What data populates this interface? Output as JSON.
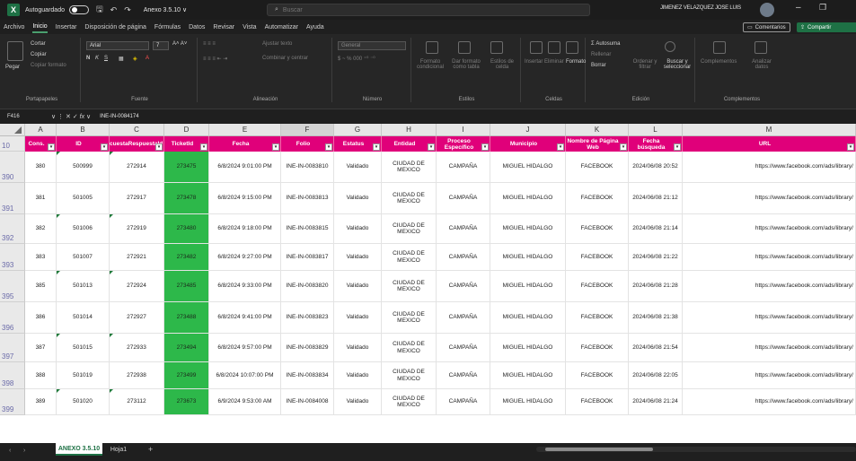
{
  "titlebar": {
    "autosave_label": "Autoguardado",
    "doc_title": "Anexo 3.5.10 ∨",
    "search_placeholder": "Buscar",
    "user_name": "JIMENEZ VELAZQUEZ JOSE LUIS"
  },
  "ribbon_tabs": [
    "Archivo",
    "Inicio",
    "Insertar",
    "Disposición de página",
    "Fórmulas",
    "Datos",
    "Revisar",
    "Vista",
    "Automatizar",
    "Ayuda"
  ],
  "ribbon_active": "Inicio",
  "ribbon_actions": {
    "comments": "Comentarios",
    "share": "Compartir"
  },
  "ribbon": {
    "clipboard": {
      "paste": "Pegar",
      "cut": "Cortar",
      "copy": "Copiar",
      "format_painter": "Copiar formato",
      "label": "Portapapeles"
    },
    "font": {
      "name": "Arial",
      "size": "7",
      "label": "Fuente"
    },
    "alignment": {
      "wrap": "Ajustar texto",
      "merge": "Combinar y centrar",
      "label": "Alineación"
    },
    "number": {
      "format": "General",
      "label": "Número"
    },
    "styles": {
      "conditional": "Formato condicional",
      "as_table": "Dar formato como tabla",
      "cell_styles": "Estilos de celda",
      "label": "Estilos"
    },
    "cells": {
      "insert": "Insertar",
      "delete": "Eliminar",
      "format": "Formato",
      "label": "Celdas"
    },
    "editing": {
      "autosum": "Autosuma",
      "fill": "Rellenar",
      "clear": "Borrar",
      "sort": "Ordenar y filtrar",
      "find": "Buscar y seleccionar",
      "label": "Edición"
    },
    "addins": {
      "addins": "Complementos",
      "analyze": "Analizar datos",
      "label": "Complementos"
    }
  },
  "formula_bar": {
    "cell_ref": "F416",
    "value": "INE-IN-0084174"
  },
  "columns": [
    "A",
    "B",
    "C",
    "D",
    "E",
    "F",
    "G",
    "H",
    "I",
    "J",
    "K",
    "L",
    "M"
  ],
  "header_row_number": "10",
  "headers": [
    "Cons.",
    "ID",
    "EncuestaRespuestaId",
    "TicketId",
    "Fecha",
    "Folio",
    "Estatus",
    "Entidad",
    "Proceso Específico",
    "Municipio",
    "Nombre de Página Web",
    "Fecha búsqueda",
    "URL"
  ],
  "rows": [
    {
      "num": "390",
      "cells": [
        "380",
        "500999",
        "272914",
        "273475",
        "6/8/2024 9:01:00 PM",
        "INE-IN-0083810",
        "Validado",
        "CIUDAD DE MEXICO",
        "CAMPAÑA",
        "MIGUEL HIDALGO",
        "FACEBOOK",
        "2024/06/08 20:52",
        "https://www.facebook.com/ads/library/"
      ]
    },
    {
      "num": "391",
      "cells": [
        "381",
        "501005",
        "272917",
        "273478",
        "6/8/2024 9:15:00 PM",
        "INE-IN-0083813",
        "Validado",
        "CIUDAD DE MEXICO",
        "CAMPAÑA",
        "MIGUEL HIDALGO",
        "FACEBOOK",
        "2024/06/08 21:12",
        "https://www.facebook.com/ads/library/"
      ]
    },
    {
      "num": "392",
      "cells": [
        "382",
        "501006",
        "272919",
        "273480",
        "6/8/2024 9:18:00 PM",
        "INE-IN-0083815",
        "Validado",
        "CIUDAD DE MEXICO",
        "CAMPAÑA",
        "MIGUEL HIDALGO",
        "FACEBOOK",
        "2024/06/08 21:14",
        "https://www.facebook.com/ads/library/"
      ]
    },
    {
      "num": "393",
      "cells": [
        "383",
        "501007",
        "272921",
        "273482",
        "6/8/2024 9:27:00 PM",
        "INE-IN-0083817",
        "Validado",
        "CIUDAD DE MEXICO",
        "CAMPAÑA",
        "MIGUEL HIDALGO",
        "FACEBOOK",
        "2024/06/08 21:22",
        "https://www.facebook.com/ads/library/"
      ]
    },
    {
      "num": "395",
      "cells": [
        "385",
        "501013",
        "272924",
        "273485",
        "6/8/2024 9:33:00 PM",
        "INE-IN-0083820",
        "Validado",
        "CIUDAD DE MEXICO",
        "CAMPAÑA",
        "MIGUEL HIDALGO",
        "FACEBOOK",
        "2024/06/08 21:28",
        "https://www.facebook.com/ads/library/"
      ]
    },
    {
      "num": "396",
      "cells": [
        "386",
        "501014",
        "272927",
        "273488",
        "6/8/2024 9:41:00 PM",
        "INE-IN-0083823",
        "Validado",
        "CIUDAD DE MEXICO",
        "CAMPAÑA",
        "MIGUEL HIDALGO",
        "FACEBOOK",
        "2024/06/08 21:38",
        "https://www.facebook.com/ads/library/"
      ]
    },
    {
      "num": "397",
      "cells": [
        "387",
        "501015",
        "272933",
        "273494",
        "6/8/2024 9:57:00 PM",
        "INE-IN-0083829",
        "Validado",
        "CIUDAD DE MEXICO",
        "CAMPAÑA",
        "MIGUEL HIDALGO",
        "FACEBOOK",
        "2024/06/08 21:54",
        "https://www.facebook.com/ads/library/"
      ]
    },
    {
      "num": "398",
      "cells": [
        "388",
        "501019",
        "272938",
        "273499",
        "6/8/2024 10:07:00 PM",
        "INE-IN-0083834",
        "Validado",
        "CIUDAD DE MEXICO",
        "CAMPAÑA",
        "MIGUEL HIDALGO",
        "FACEBOOK",
        "2024/06/08 22:05",
        "https://www.facebook.com/ads/library/"
      ]
    },
    {
      "num": "399",
      "cells": [
        "389",
        "501020",
        "273112",
        "273673",
        "6/9/2024 9:53:00 AM",
        "INE-IN-0084008",
        "Validado",
        "CIUDAD DE MEXICO",
        "CAMPAÑA",
        "MIGUEL HIDALGO",
        "FACEBOOK",
        "2024/06/08 21:24",
        "https://www.facebook.com/ads/library/"
      ]
    }
  ],
  "sheets": {
    "active": "ANEXO 3.5.10",
    "other": "Hoja1"
  },
  "colors": {
    "header_bg": "#e0007a",
    "ticket_green": "#2db84a",
    "brand": "#1e7145"
  }
}
